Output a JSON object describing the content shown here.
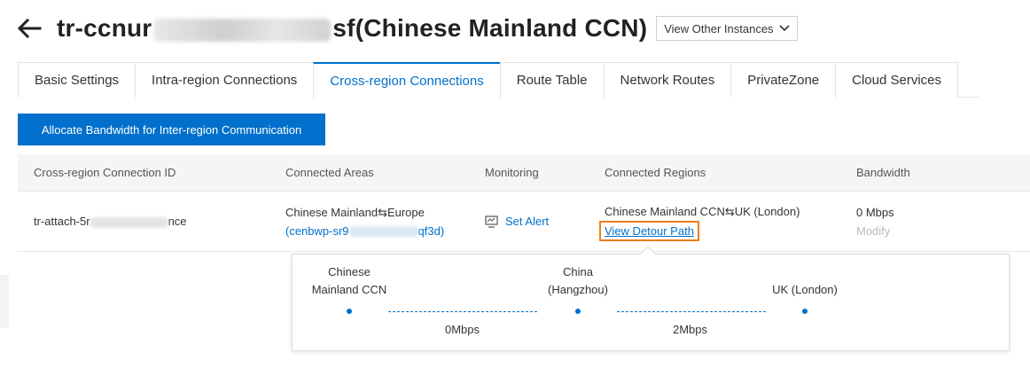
{
  "header": {
    "title_prefix": "tr-ccnur",
    "title_suffix": "sf(Chinese Mainland CCN)",
    "other_instances_label": "View Other Instances"
  },
  "tabs": [
    {
      "label": "Basic Settings",
      "active": false
    },
    {
      "label": "Intra-region Connections",
      "active": false
    },
    {
      "label": "Cross-region Connections",
      "active": true
    },
    {
      "label": "Route Table",
      "active": false
    },
    {
      "label": "Network Routes",
      "active": false
    },
    {
      "label": "PrivateZone",
      "active": false
    },
    {
      "label": "Cloud Services",
      "active": false
    }
  ],
  "actions": {
    "allocate_bandwidth_label": "Allocate Bandwidth for Inter-region Communication"
  },
  "table": {
    "columns": [
      "Cross-region Connection ID",
      "Connected Areas",
      "Monitoring",
      "Connected Regions",
      "Bandwidth"
    ],
    "row": {
      "id_prefix": "tr-attach-5r",
      "id_suffix": "nce",
      "areas": "Chinese Mainland⇆Europe",
      "area_id_prefix": "(cenbwp-sr9",
      "area_id_suffix": "qf3d)",
      "monitoring": "Set Alert",
      "regions": "Chinese Mainland CCN⇆UK (London)",
      "detour_link": "View Detour Path",
      "bandwidth": "0 Mbps",
      "modify": "Modify"
    }
  },
  "detour_path": {
    "nodes": [
      {
        "line1": "Chinese",
        "line2": "Mainland CCN"
      },
      {
        "line1": "China",
        "line2": "(Hangzhou)"
      },
      {
        "line1": "UK (London)",
        "line2": ""
      }
    ],
    "links": [
      {
        "bandwidth": "0Mbps"
      },
      {
        "bandwidth": "2Mbps"
      }
    ]
  },
  "colors": {
    "accent": "#0070cc",
    "highlight_border": "#f07c1e"
  }
}
